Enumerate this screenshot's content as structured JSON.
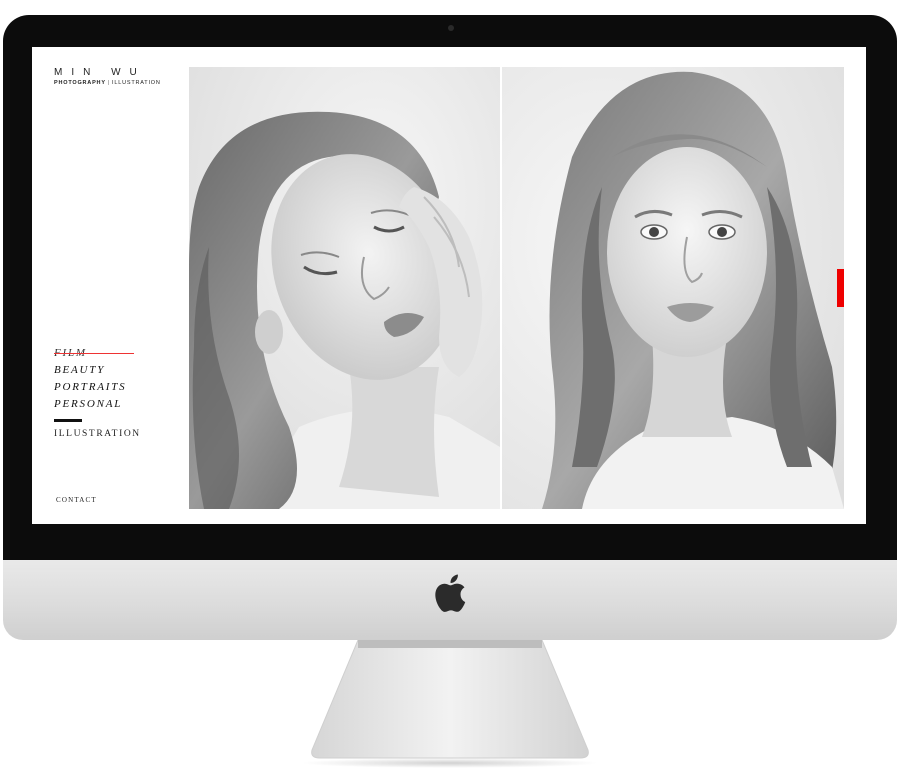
{
  "site": {
    "brand_name": "MIN WU",
    "brand_sub_primary": "PHOTOGRAPHY",
    "brand_sub_separator": "|",
    "brand_sub_secondary": "ILLUSTRATION"
  },
  "nav": {
    "items": [
      {
        "label": "FILM",
        "active": true
      },
      {
        "label": "BEAUTY",
        "active": false
      },
      {
        "label": "PORTRAITS",
        "active": false
      },
      {
        "label": "PERSONAL",
        "active": false
      }
    ],
    "secondary": "ILLUSTRATION",
    "contact": "CONTACT"
  },
  "gallery": {
    "photos": [
      {
        "subject": "portrait-eyes-closed"
      },
      {
        "subject": "portrait-looking-at-camera"
      }
    ]
  },
  "colors": {
    "accent": "#ee0000",
    "bezel": "#0c0c0c",
    "strike": "#e33333"
  }
}
